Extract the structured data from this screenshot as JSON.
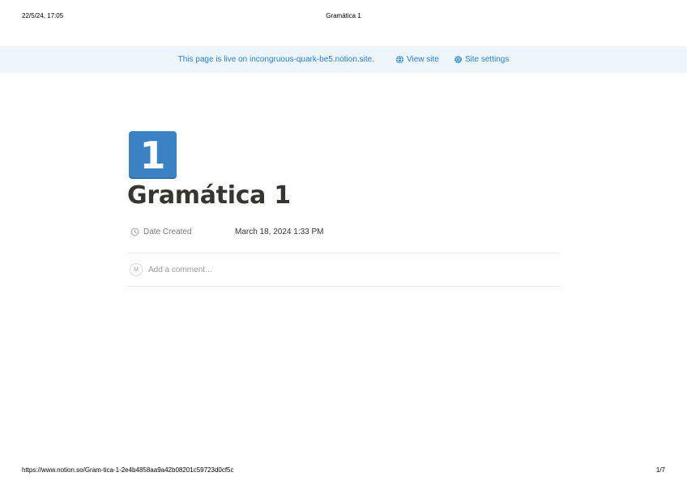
{
  "print_header": {
    "datetime": "22/5/24, 17:05",
    "title": "Gramática 1"
  },
  "banner": {
    "message": "This page is live on incongruous-quark-be5.notion.site.",
    "view_site_label": "View site",
    "site_settings_label": "Site settings"
  },
  "page": {
    "icon_text": "1",
    "title": "Gramática 1",
    "properties": [
      {
        "name": "Date Created",
        "value": "March 18, 2024 1:33 PM",
        "icon": "clock-icon"
      }
    ],
    "comment": {
      "avatar_initial": "M",
      "placeholder": "Add a comment..."
    }
  },
  "print_footer": {
    "url": "https://www.notion.so/Gram-tica-1-2e4b4858aa9a42b08201c59723d0cf5c",
    "page_number": "1/7"
  },
  "colors": {
    "banner_bg": "#eef5fb",
    "link": "#2383e2",
    "icon_bg": "#3b82c4",
    "text": "#37352f",
    "muted": "#787774"
  }
}
